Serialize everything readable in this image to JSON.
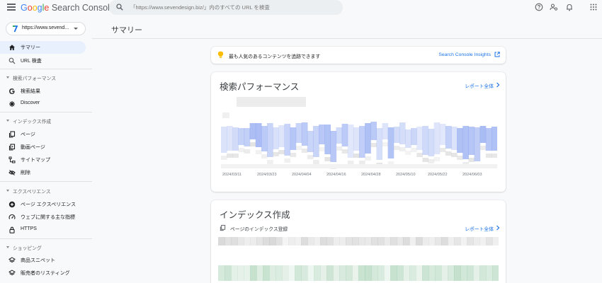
{
  "header": {
    "app_name_google": "Google",
    "app_name_product": "Search Console",
    "search_placeholder": "「https://www.sevendesign.biz/」内のすべての URL を検査",
    "icons": [
      "menu-icon",
      "search-icon",
      "help-icon",
      "manage-users-icon",
      "notifications-icon",
      "apps-grid-icon"
    ]
  },
  "property": {
    "label": "https://www.sevend...",
    "favicon": "site-favicon"
  },
  "sidebar": {
    "items": [
      {
        "label": "サマリー",
        "icon": "home-icon",
        "active": true
      },
      {
        "label": "URL 検査",
        "icon": "search-icon",
        "active": false
      }
    ],
    "sections": [
      {
        "title": "検索パフォーマンス",
        "items": [
          {
            "label": "検索結果",
            "icon": "google-g-icon"
          },
          {
            "label": "Discover",
            "icon": "asterisk-icon"
          }
        ]
      },
      {
        "title": "インデックス作成",
        "items": [
          {
            "label": "ページ",
            "icon": "pages-icon"
          },
          {
            "label": "動画ページ",
            "icon": "video-pages-icon"
          },
          {
            "label": "サイトマップ",
            "icon": "sitemap-icon"
          },
          {
            "label": "削除",
            "icon": "removals-icon"
          }
        ]
      },
      {
        "title": "エクスペリエンス",
        "items": [
          {
            "label": "ページ エクスペリエンス",
            "icon": "page-experience-icon"
          },
          {
            "label": "ウェブに関する主な指標",
            "icon": "web-vitals-icon"
          },
          {
            "label": "HTTPS",
            "icon": "lock-icon"
          }
        ]
      },
      {
        "title": "ショッピング",
        "items": [
          {
            "label": "商品スニペット",
            "icon": "layers-icon"
          },
          {
            "label": "販売者のリスティング",
            "icon": "layers-icon"
          }
        ]
      }
    ]
  },
  "main": {
    "page_title": "サマリー",
    "insights": {
      "text": "最も人気のあるコンテンツを追跡できます",
      "link": "Search Console Insights"
    },
    "performance": {
      "title": "検索パフォーマンス",
      "report_link": "レポート全体",
      "dates": [
        "2024/03/11",
        "2024/03/23",
        "2024/04/04",
        "2024/04/16",
        "2024/04/28",
        "2024/05/10",
        "2024/05/22",
        "2024/06/03"
      ]
    },
    "indexing": {
      "title": "インデックス作成",
      "subtitle": "ページのインデックス登録",
      "report_link": "レポート全体"
    }
  },
  "colors": {
    "accent": "#1a73e8",
    "active_bg": "#e8f0fe",
    "chart_blue": "#c6d4f7",
    "chart_green": "#cfe6d6"
  }
}
